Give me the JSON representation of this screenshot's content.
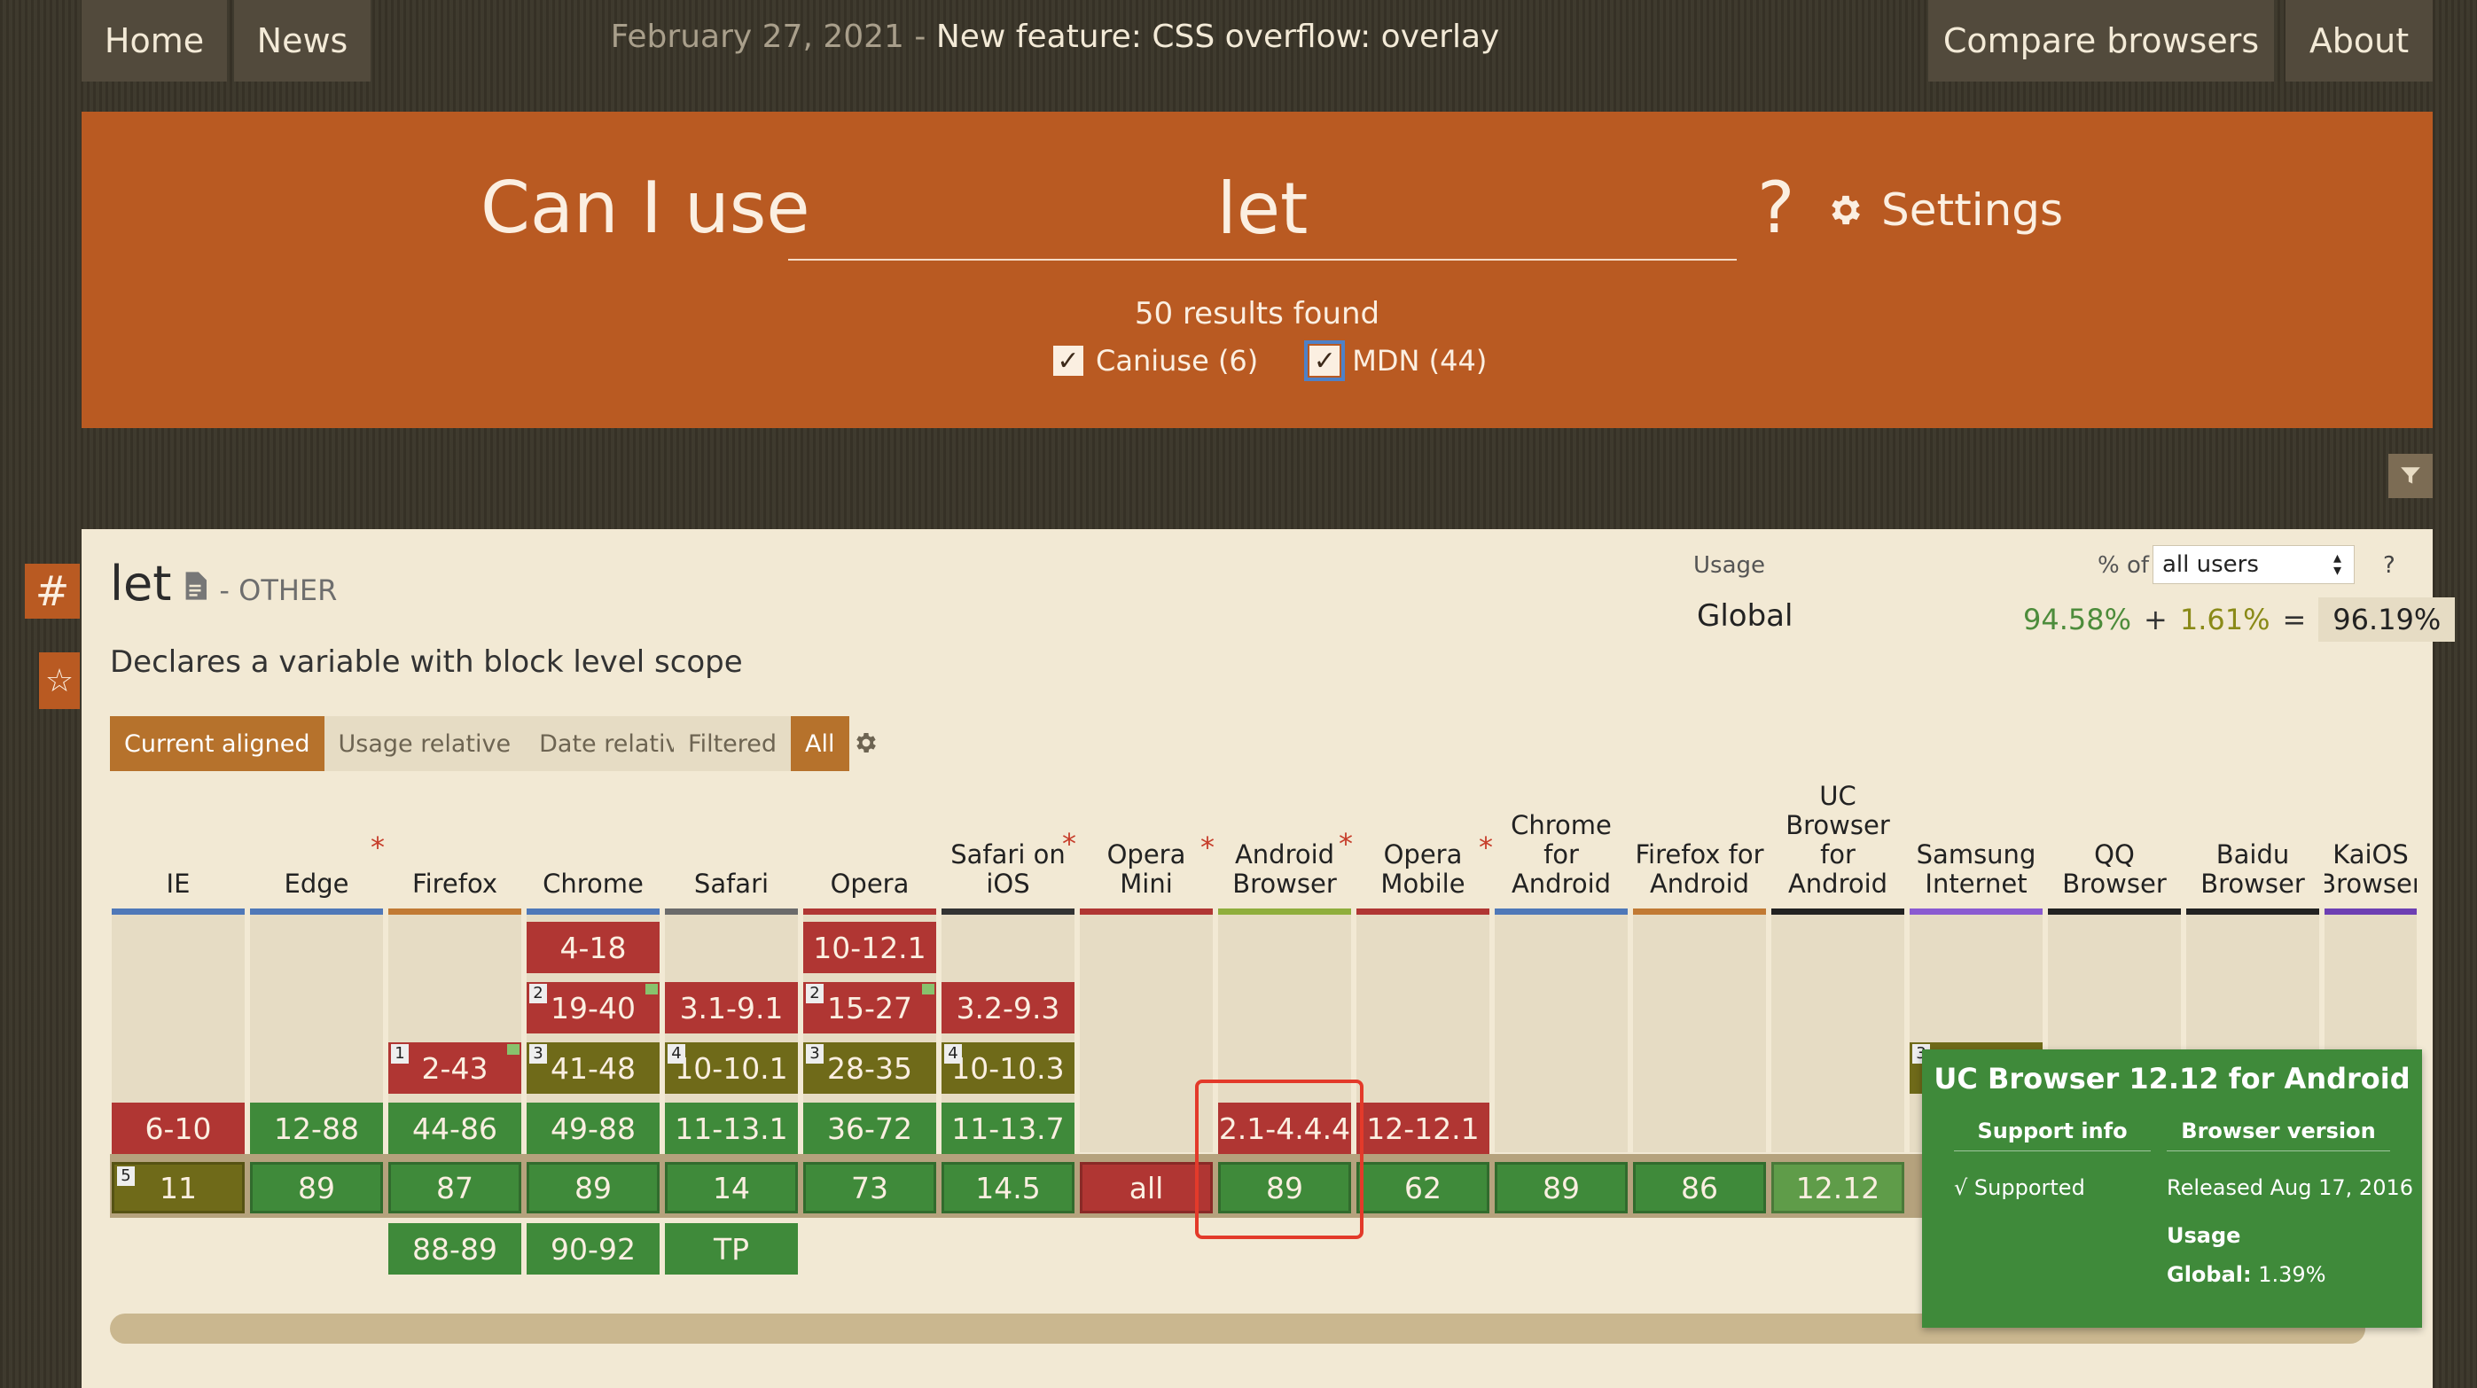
{
  "nav": {
    "home": "Home",
    "news": "News",
    "compare": "Compare browsers",
    "about": "About",
    "headline_date": "February 27, 2021",
    "headline_sep": " - ",
    "headline_news": "New feature: CSS overflow: overlay"
  },
  "search": {
    "prefix": "Can I use",
    "value": "let",
    "suffix": "?",
    "settings_label": "Settings",
    "results": "50 results found",
    "filters": [
      {
        "label": "Caniuse (6)",
        "checked": true
      },
      {
        "label": "MDN (44)",
        "checked": true
      }
    ]
  },
  "side_tabs": {
    "hash": "#",
    "star": "☆"
  },
  "feature": {
    "title": "let",
    "category": "- OTHER",
    "description": "Declares a variable with block level scope"
  },
  "usage": {
    "label": "Usage",
    "pct_of": "% of",
    "users_select": "all users",
    "help": "?",
    "region": "Global",
    "supported": "94.58%",
    "plus": "+",
    "partial": "1.61%",
    "equals": "=",
    "total": "96.19%"
  },
  "view_buttons": [
    "Current aligned",
    "Usage relative",
    "Date relative"
  ],
  "filter_buttons": [
    "Filtered",
    "All"
  ],
  "browsers": [
    "IE",
    "Edge",
    "Firefox",
    "Chrome",
    "Safari",
    "Opera",
    "Safari on iOS",
    "Opera Mini",
    "Android Browser",
    "Opera Mobile",
    "Chrome for Android",
    "Firefox for Android",
    "UC Browser for Android",
    "Samsung Internet",
    "QQ Browser",
    "Baidu Browser",
    "KaiOS Browser"
  ],
  "cells": {
    "ie_1": "6-10",
    "ie_cur": "11",
    "ie_cur_note": "5",
    "edge_1": "12-88",
    "edge_cur": "89",
    "ff_1": "2-43",
    "ff_1_note": "1",
    "ff_2": "44-86",
    "ff_cur": "87",
    "ff_f": "88-89",
    "ch_1": "4-18",
    "ch_2": "19-40",
    "ch_2_note": "2",
    "ch_3": "41-48",
    "ch_3_note": "3",
    "ch_4": "49-88",
    "ch_cur": "89",
    "ch_f": "90-92",
    "sa_1": "3.1-9.1",
    "sa_2": "10-10.1",
    "sa_2_note": "4",
    "sa_3": "11-13.1",
    "sa_cur": "14",
    "sa_f": "TP",
    "op_1": "10-12.1",
    "op_2": "15-27",
    "op_2_note": "2",
    "op_3": "28-35",
    "op_3_note": "3",
    "op_4": "36-72",
    "op_cur": "73",
    "ios_1": "3.2-9.3",
    "ios_2": "10-10.3",
    "ios_2_note": "4",
    "ios_3": "11-13.7",
    "ios_cur": "14.5",
    "om_cur": "all",
    "ab_1": "2.1-4.4.4",
    "ab_cur": "89",
    "omob_1": "12-12.1",
    "omob_cur": "62",
    "cfa_cur": "89",
    "ffa_cur": "86",
    "uc_cur": "12.12",
    "sam_note": "3"
  },
  "tooltip": {
    "title": "UC Browser 12.12 for Android",
    "col1": "Support info",
    "col2": "Browser version",
    "supported": "√ Supported",
    "released": "Released Aug 17, 2016",
    "usage_label": "Usage",
    "global_label": "Global:",
    "global_value": "1.39%"
  },
  "colors": {
    "accent": "#b95a22",
    "supported": "#3f8a3a",
    "not_supported": "#b03633",
    "partial": "#6f6a19"
  }
}
